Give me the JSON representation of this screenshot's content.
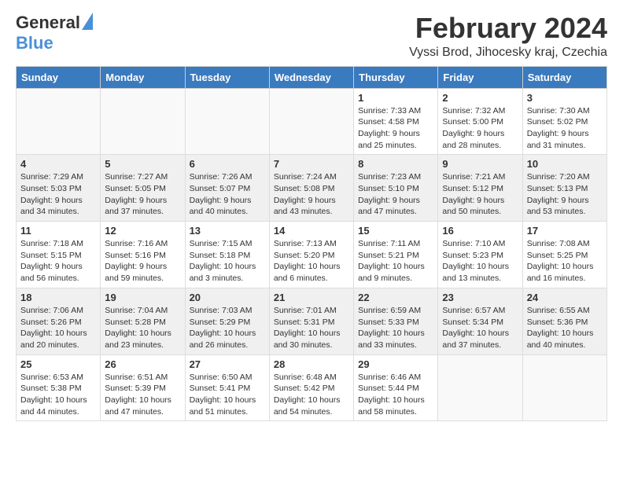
{
  "header": {
    "logo_general": "General",
    "logo_blue": "Blue",
    "title": "February 2024",
    "subtitle": "Vyssi Brod, Jihocesky kraj, Czechia"
  },
  "weekdays": [
    "Sunday",
    "Monday",
    "Tuesday",
    "Wednesday",
    "Thursday",
    "Friday",
    "Saturday"
  ],
  "weeks": [
    [
      {
        "day": "",
        "sunrise": "",
        "sunset": "",
        "daylight": ""
      },
      {
        "day": "",
        "sunrise": "",
        "sunset": "",
        "daylight": ""
      },
      {
        "day": "",
        "sunrise": "",
        "sunset": "",
        "daylight": ""
      },
      {
        "day": "",
        "sunrise": "",
        "sunset": "",
        "daylight": ""
      },
      {
        "day": "1",
        "sunrise": "Sunrise: 7:33 AM",
        "sunset": "Sunset: 4:58 PM",
        "daylight": "Daylight: 9 hours and 25 minutes."
      },
      {
        "day": "2",
        "sunrise": "Sunrise: 7:32 AM",
        "sunset": "Sunset: 5:00 PM",
        "daylight": "Daylight: 9 hours and 28 minutes."
      },
      {
        "day": "3",
        "sunrise": "Sunrise: 7:30 AM",
        "sunset": "Sunset: 5:02 PM",
        "daylight": "Daylight: 9 hours and 31 minutes."
      }
    ],
    [
      {
        "day": "4",
        "sunrise": "Sunrise: 7:29 AM",
        "sunset": "Sunset: 5:03 PM",
        "daylight": "Daylight: 9 hours and 34 minutes."
      },
      {
        "day": "5",
        "sunrise": "Sunrise: 7:27 AM",
        "sunset": "Sunset: 5:05 PM",
        "daylight": "Daylight: 9 hours and 37 minutes."
      },
      {
        "day": "6",
        "sunrise": "Sunrise: 7:26 AM",
        "sunset": "Sunset: 5:07 PM",
        "daylight": "Daylight: 9 hours and 40 minutes."
      },
      {
        "day": "7",
        "sunrise": "Sunrise: 7:24 AM",
        "sunset": "Sunset: 5:08 PM",
        "daylight": "Daylight: 9 hours and 43 minutes."
      },
      {
        "day": "8",
        "sunrise": "Sunrise: 7:23 AM",
        "sunset": "Sunset: 5:10 PM",
        "daylight": "Daylight: 9 hours and 47 minutes."
      },
      {
        "day": "9",
        "sunrise": "Sunrise: 7:21 AM",
        "sunset": "Sunset: 5:12 PM",
        "daylight": "Daylight: 9 hours and 50 minutes."
      },
      {
        "day": "10",
        "sunrise": "Sunrise: 7:20 AM",
        "sunset": "Sunset: 5:13 PM",
        "daylight": "Daylight: 9 hours and 53 minutes."
      }
    ],
    [
      {
        "day": "11",
        "sunrise": "Sunrise: 7:18 AM",
        "sunset": "Sunset: 5:15 PM",
        "daylight": "Daylight: 9 hours and 56 minutes."
      },
      {
        "day": "12",
        "sunrise": "Sunrise: 7:16 AM",
        "sunset": "Sunset: 5:16 PM",
        "daylight": "Daylight: 9 hours and 59 minutes."
      },
      {
        "day": "13",
        "sunrise": "Sunrise: 7:15 AM",
        "sunset": "Sunset: 5:18 PM",
        "daylight": "Daylight: 10 hours and 3 minutes."
      },
      {
        "day": "14",
        "sunrise": "Sunrise: 7:13 AM",
        "sunset": "Sunset: 5:20 PM",
        "daylight": "Daylight: 10 hours and 6 minutes."
      },
      {
        "day": "15",
        "sunrise": "Sunrise: 7:11 AM",
        "sunset": "Sunset: 5:21 PM",
        "daylight": "Daylight: 10 hours and 9 minutes."
      },
      {
        "day": "16",
        "sunrise": "Sunrise: 7:10 AM",
        "sunset": "Sunset: 5:23 PM",
        "daylight": "Daylight: 10 hours and 13 minutes."
      },
      {
        "day": "17",
        "sunrise": "Sunrise: 7:08 AM",
        "sunset": "Sunset: 5:25 PM",
        "daylight": "Daylight: 10 hours and 16 minutes."
      }
    ],
    [
      {
        "day": "18",
        "sunrise": "Sunrise: 7:06 AM",
        "sunset": "Sunset: 5:26 PM",
        "daylight": "Daylight: 10 hours and 20 minutes."
      },
      {
        "day": "19",
        "sunrise": "Sunrise: 7:04 AM",
        "sunset": "Sunset: 5:28 PM",
        "daylight": "Daylight: 10 hours and 23 minutes."
      },
      {
        "day": "20",
        "sunrise": "Sunrise: 7:03 AM",
        "sunset": "Sunset: 5:29 PM",
        "daylight": "Daylight: 10 hours and 26 minutes."
      },
      {
        "day": "21",
        "sunrise": "Sunrise: 7:01 AM",
        "sunset": "Sunset: 5:31 PM",
        "daylight": "Daylight: 10 hours and 30 minutes."
      },
      {
        "day": "22",
        "sunrise": "Sunrise: 6:59 AM",
        "sunset": "Sunset: 5:33 PM",
        "daylight": "Daylight: 10 hours and 33 minutes."
      },
      {
        "day": "23",
        "sunrise": "Sunrise: 6:57 AM",
        "sunset": "Sunset: 5:34 PM",
        "daylight": "Daylight: 10 hours and 37 minutes."
      },
      {
        "day": "24",
        "sunrise": "Sunrise: 6:55 AM",
        "sunset": "Sunset: 5:36 PM",
        "daylight": "Daylight: 10 hours and 40 minutes."
      }
    ],
    [
      {
        "day": "25",
        "sunrise": "Sunrise: 6:53 AM",
        "sunset": "Sunset: 5:38 PM",
        "daylight": "Daylight: 10 hours and 44 minutes."
      },
      {
        "day": "26",
        "sunrise": "Sunrise: 6:51 AM",
        "sunset": "Sunset: 5:39 PM",
        "daylight": "Daylight: 10 hours and 47 minutes."
      },
      {
        "day": "27",
        "sunrise": "Sunrise: 6:50 AM",
        "sunset": "Sunset: 5:41 PM",
        "daylight": "Daylight: 10 hours and 51 minutes."
      },
      {
        "day": "28",
        "sunrise": "Sunrise: 6:48 AM",
        "sunset": "Sunset: 5:42 PM",
        "daylight": "Daylight: 10 hours and 54 minutes."
      },
      {
        "day": "29",
        "sunrise": "Sunrise: 6:46 AM",
        "sunset": "Sunset: 5:44 PM",
        "daylight": "Daylight: 10 hours and 58 minutes."
      },
      {
        "day": "",
        "sunrise": "",
        "sunset": "",
        "daylight": ""
      },
      {
        "day": "",
        "sunrise": "",
        "sunset": "",
        "daylight": ""
      }
    ]
  ]
}
